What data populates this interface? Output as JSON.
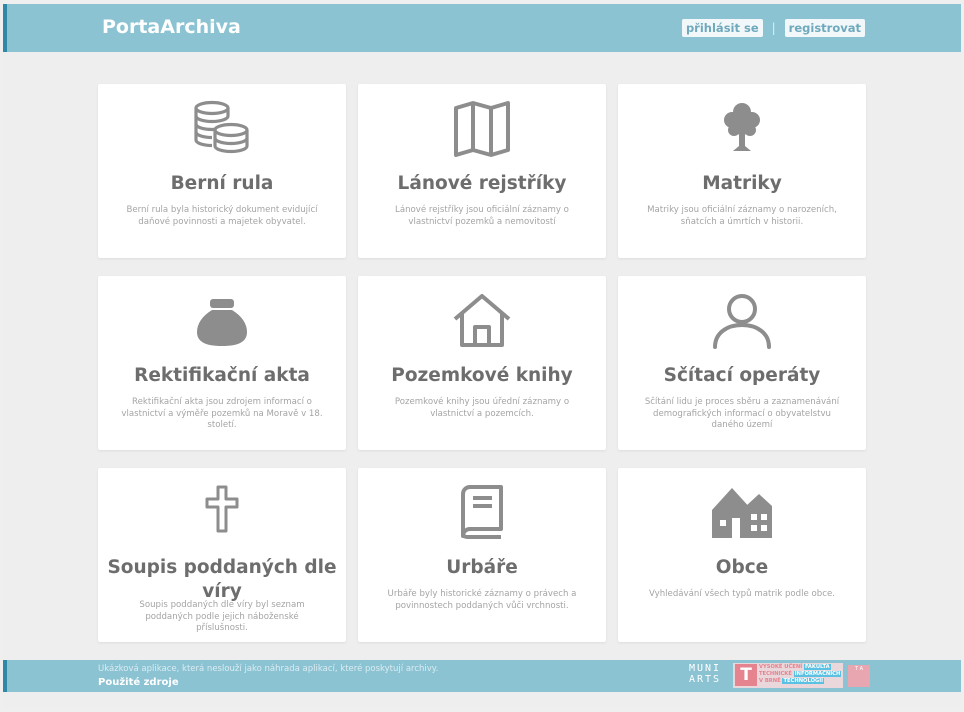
{
  "header": {
    "brand": "PortaArchiva",
    "login_label": "přihlásit se",
    "separator": "|",
    "register_label": "registrovat"
  },
  "cards": [
    {
      "title": "Berní rula",
      "description": "Berní rula byla historický dokument evidující daňové povinnosti a majetek obyvatel.",
      "icon": "coins-icon"
    },
    {
      "title": "Lánové rejstříky",
      "description": "Lánové rejstříky jsou oficiální záznamy o vlastnictví pozemků a nemovitostí",
      "icon": "map-icon"
    },
    {
      "title": "Matriky",
      "description": "Matriky jsou oficiální záznamy o narozeních, sňatcích a úmrtích v historii.",
      "icon": "tree-icon"
    },
    {
      "title": "Rektifikační akta",
      "description": "Rektifikační akta jsou zdrojem informací o vlastnictví a výměře pozemků na Moravě v 18. století.",
      "icon": "money-bag-icon"
    },
    {
      "title": "Pozemkové knihy",
      "description": "Pozemkové knihy jsou úřední záznamy o vlastnictví a pozemcích.",
      "icon": "house-icon"
    },
    {
      "title": "Sčítací operáty",
      "description": "Sčítání lidu je proces sběru a zaznamenávání demografických informací o obyvatelstvu daného území",
      "icon": "person-icon"
    },
    {
      "title": "Soupis poddaných dle víry",
      "description": "Soupis poddaných dle víry byl seznam poddaných podle jejich náboženské příslušnosti.",
      "icon": "cross-icon"
    },
    {
      "title": "Urbáře",
      "description": "Urbáře byly historické záznamy o právech a povinnostech poddaných vůči vrchnosti.",
      "icon": "book-icon"
    },
    {
      "title": "Obce",
      "description": "Vyhledávání všech typů matrik podle obce.",
      "icon": "village-icon"
    }
  ],
  "footer": {
    "note": "Ukázková aplikace, která neslouží jako náhrada aplikací, které poskytují archivy.",
    "sources_label": "Použité zdroje",
    "muni_line1": "MUNI",
    "muni_line2": "ARTS",
    "vut_logo_letter": "T",
    "vut_line1": "VYSOKÉ UČENÍ",
    "vut_line1b": "FAKULTA",
    "vut_line2": "TECHNICKÉ",
    "vut_line2b": "INFORMAČNÍCH",
    "vut_line3": "V BRNĚ",
    "vut_line3b": "TECHNOLOGIÍ",
    "side_logo_text": "T A"
  },
  "colors": {
    "header_bg": "#8cc3d2",
    "accent": "#2f89a6",
    "icon_gray": "#8d8d8d"
  }
}
